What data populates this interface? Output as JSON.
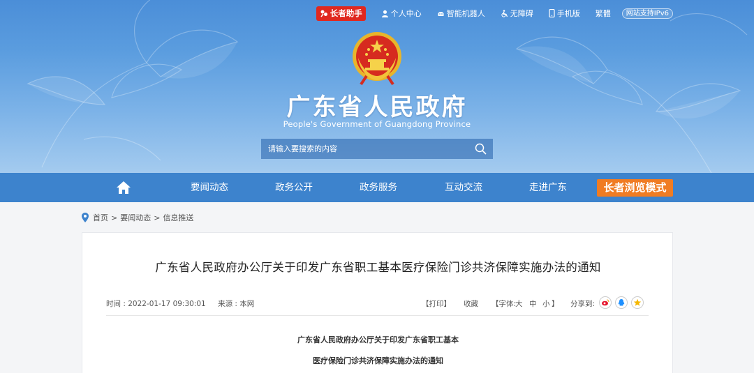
{
  "topbar": {
    "elder_assistant": "长者助手",
    "personal_center": "个人中心",
    "robot": "智能机器人",
    "accessibility": "无障碍",
    "mobile": "手机版",
    "traditional": "繁體",
    "ipv6": "网站支持IPv6"
  },
  "header": {
    "title": "广东省人民政府",
    "subtitle": "People's Government of Guangdong Province"
  },
  "search": {
    "placeholder": "请输入要搜索的内容"
  },
  "nav": {
    "items": [
      "要闻动态",
      "政务公开",
      "政务服务",
      "互动交流",
      "走进广东"
    ],
    "elder_mode": "长者浏览模式"
  },
  "breadcrumb": {
    "items": [
      "首页",
      "要闻动态",
      "信息推送"
    ],
    "separator": ">"
  },
  "article": {
    "title": "广东省人民政府办公厅关于印发广东省职工基本医疗保险门诊共济保障实施办法的通知",
    "time": "时间 : 2022-01-17 09:30:01",
    "source": "来源 : 本网",
    "print": "【打印】",
    "favorite": "收藏",
    "font_label": "【字体:",
    "font_large": "大",
    "font_medium": "中",
    "font_small": "小",
    "font_end": "】",
    "share_label": "分享到:",
    "body_heading_line1": "广东省人民政府办公厅关于印发广东省职工基本",
    "body_heading_line2": "医疗保险门诊共济保障实施办法的通知"
  },
  "colors": {
    "nav_bg": "#3d83cd",
    "elder_red": "#e0281f",
    "elder_orange": "#f07c23"
  }
}
